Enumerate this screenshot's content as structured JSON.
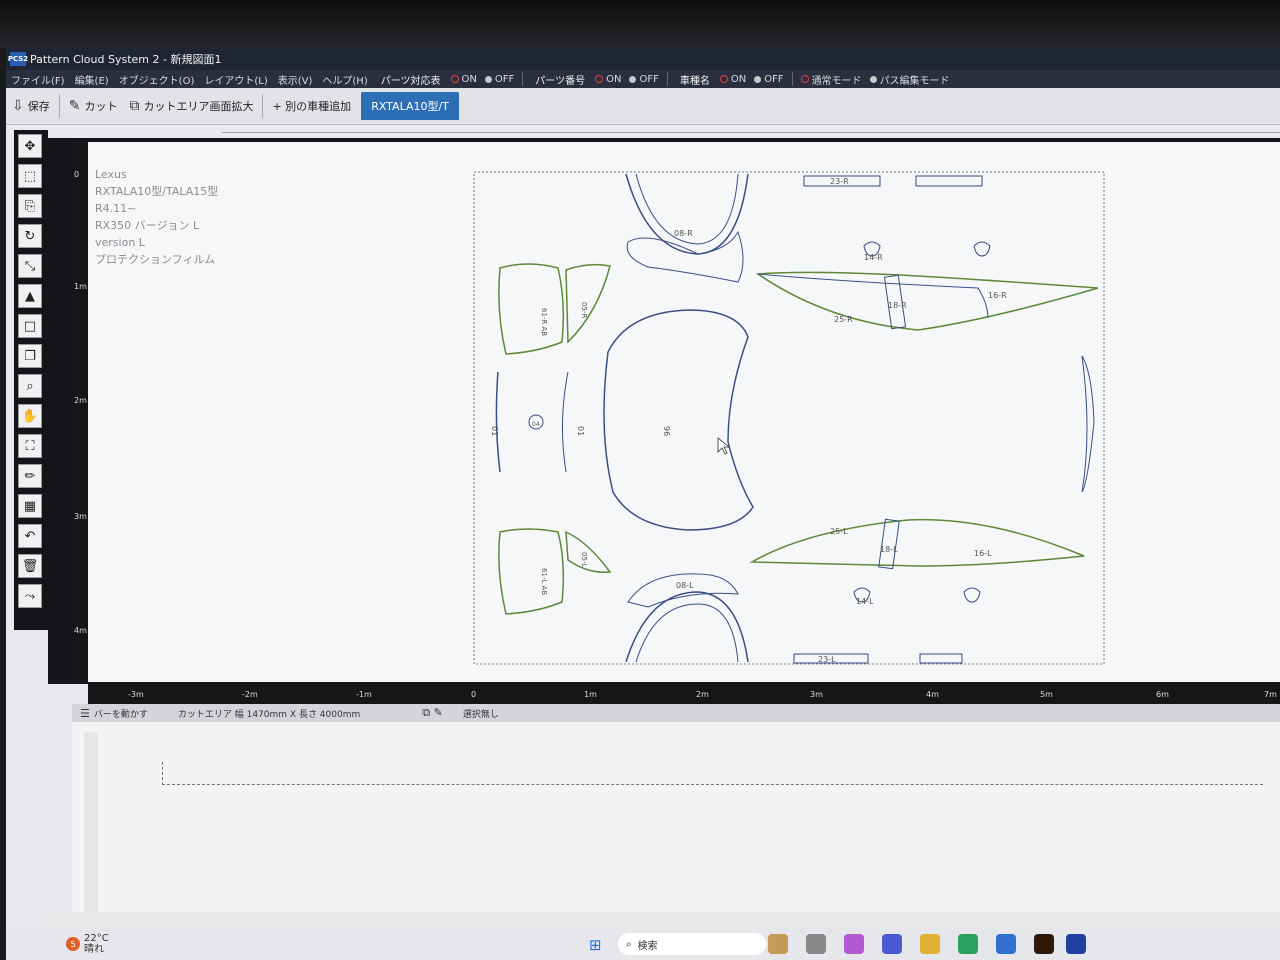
{
  "window": {
    "title": "Pattern Cloud System 2 - 新規図面1",
    "logo_text": "PCS2"
  },
  "menu": {
    "items": [
      "ファイル(F)",
      "編集(E)",
      "オブジェクト(O)",
      "レイアウト(L)",
      "表示(V)",
      "ヘルプ(H)"
    ],
    "parts_table_label": "パーツ対応表",
    "parts_number_label": "パーツ番号",
    "model_name_label": "車種名",
    "on": "ON",
    "off": "OFF",
    "normal_mode": "通常モード",
    "path_edit_mode": "パス編集モード"
  },
  "toolbar": {
    "save": "保存",
    "cut": "カット",
    "cut_area_zoom": "カットエリア画面拡大",
    "add_model": "+ 別の車種追加",
    "active_tab": "RXTALA10型/T"
  },
  "info_text": {
    "line1": "Lexus",
    "line2": "RXTALA10型/TALA15型",
    "line3": "R4.11~",
    "line4": "RX350 バージョン L",
    "line5": "version L",
    "line6": "プロテクションフィルム"
  },
  "ruler": {
    "h_ticks": [
      "-3m",
      "-2m",
      "-1m",
      "0",
      "1m",
      "2m",
      "3m",
      "4m",
      "5m",
      "6m",
      "7m"
    ],
    "v_ticks": [
      "0",
      "1m",
      "2m",
      "3m",
      "4m"
    ]
  },
  "status": {
    "move_bar": "バーを動かす",
    "cut_area": "カットエリア 幅 1470mm X 長さ 4000mm",
    "selection": "選択無し"
  },
  "taskbar": {
    "weather_badge": "5",
    "temperature": "22°C",
    "weather": "晴れ",
    "search": "検索"
  },
  "pattern_labels": {
    "hood": "96",
    "bumper_center": "01",
    "bumper_left": "01",
    "fender_r": "08-R",
    "fender_l": "08-L",
    "door_r": "25-R",
    "door_l": "25-L",
    "rocker_r": "18-R",
    "rocker_l": "18-L",
    "mirror_r": "16-R",
    "mirror_l": "16-L",
    "roof_top_r": "23-R",
    "roof_top_l": "23-L",
    "handle_r": "14-R",
    "handle_l": "14-L",
    "hl_r": "61-R AB",
    "hl_l": "61-L AB",
    "fog_r": "05-R",
    "fog_l": "05-L",
    "emblem": "04"
  },
  "colors": {
    "accent_tab": "#2c6fb4",
    "pattern_blue": "#3a4e86",
    "pattern_green": "#5c8a38"
  }
}
